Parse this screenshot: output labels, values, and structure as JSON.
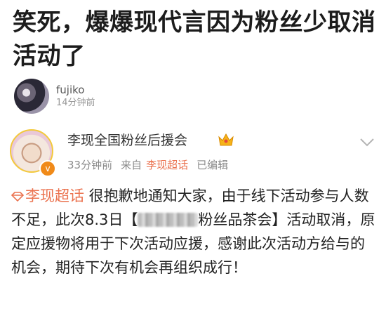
{
  "post": {
    "title": "笑死，爆爆现代言因为粉丝少取消活动了",
    "author_name": "fujiko",
    "author_time": "14分钟前"
  },
  "embedded": {
    "account_name": "李现全国粉丝后援会",
    "meta": {
      "time": "33分钟前",
      "source_prefix": "来自",
      "source": "李现超话",
      "edited": "已编辑"
    },
    "topic_tag": "李现超话",
    "text_part1": " 很抱歉地通知大家，由于线下活动参与人数不足，此次8.3日【",
    "text_part2": "粉丝品茶会】活动取消，原定应援物将用于下次活动应援，感谢此次活动方给与的机会，期待下次有机会再组织成行！"
  },
  "icons": {
    "crown": "crown-icon",
    "chevron": "chevron-down-icon",
    "diamond": "diamond-icon",
    "vip": "vip-badge-icon"
  },
  "colors": {
    "topic": "#eb7350",
    "meta": "#8a8a8a",
    "badge": "#f08a19"
  }
}
